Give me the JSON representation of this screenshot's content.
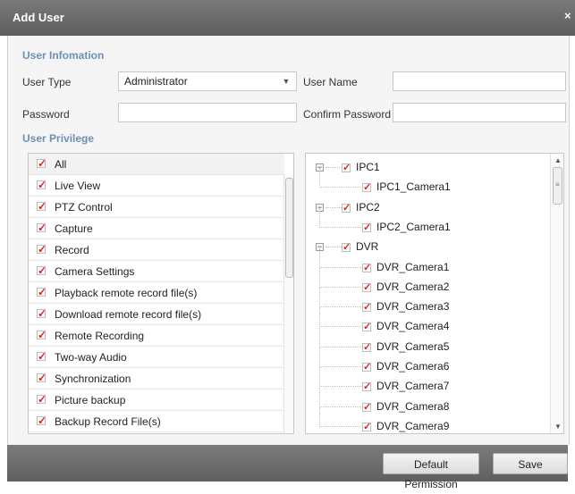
{
  "dialog": {
    "title": "Add User",
    "close_glyph": "×"
  },
  "info": {
    "section": "User Infomation",
    "user_type_label": "User Type",
    "user_type_value": "Administrator",
    "user_name_label": "User Name",
    "user_name_value": "",
    "password_label": "Password",
    "password_value": "",
    "confirm_label": "Confirm Password",
    "confirm_value": ""
  },
  "privilege": {
    "section": "User Privilege",
    "items": [
      {
        "label": "All",
        "checked": true
      },
      {
        "label": "Live View",
        "checked": true
      },
      {
        "label": "PTZ Control",
        "checked": true
      },
      {
        "label": "Capture",
        "checked": true
      },
      {
        "label": "Record",
        "checked": true
      },
      {
        "label": "Camera Settings",
        "checked": true
      },
      {
        "label": "Playback remote record file(s)",
        "checked": true
      },
      {
        "label": "Download remote record file(s)",
        "checked": true
      },
      {
        "label": "Remote Recording",
        "checked": true
      },
      {
        "label": "Two-way Audio",
        "checked": true
      },
      {
        "label": "Synchronization",
        "checked": true
      },
      {
        "label": "Picture backup",
        "checked": true
      },
      {
        "label": "Backup Record File(s)",
        "checked": true
      }
    ]
  },
  "tree": {
    "nodes": [
      {
        "label": "IPC1",
        "level": 0,
        "checked": true,
        "expanded": true
      },
      {
        "label": "IPC1_Camera1",
        "level": 1,
        "checked": true
      },
      {
        "label": "IPC2",
        "level": 0,
        "checked": true,
        "expanded": true
      },
      {
        "label": "IPC2_Camera1",
        "level": 1,
        "checked": true
      },
      {
        "label": "DVR",
        "level": 0,
        "checked": true,
        "expanded": true
      },
      {
        "label": "DVR_Camera1",
        "level": 1,
        "checked": true
      },
      {
        "label": "DVR_Camera2",
        "level": 1,
        "checked": true
      },
      {
        "label": "DVR_Camera3",
        "level": 1,
        "checked": true
      },
      {
        "label": "DVR_Camera4",
        "level": 1,
        "checked": true
      },
      {
        "label": "DVR_Camera5",
        "level": 1,
        "checked": true
      },
      {
        "label": "DVR_Camera6",
        "level": 1,
        "checked": true
      },
      {
        "label": "DVR_Camera7",
        "level": 1,
        "checked": true
      },
      {
        "label": "DVR_Camera8",
        "level": 1,
        "checked": true
      },
      {
        "label": "DVR_Camera9",
        "level": 1,
        "checked": true
      }
    ]
  },
  "buttons": {
    "default_permission": "Default Permission",
    "save": "Save"
  },
  "icons": {
    "check": "checkmark-icon",
    "collapse": "minus-toggle-icon",
    "dropdown": "chevron-down-icon"
  },
  "colors": {
    "section_text": "#6f8fb5",
    "check_mark": "#d22222",
    "titlebar": "#6a6a6a"
  }
}
